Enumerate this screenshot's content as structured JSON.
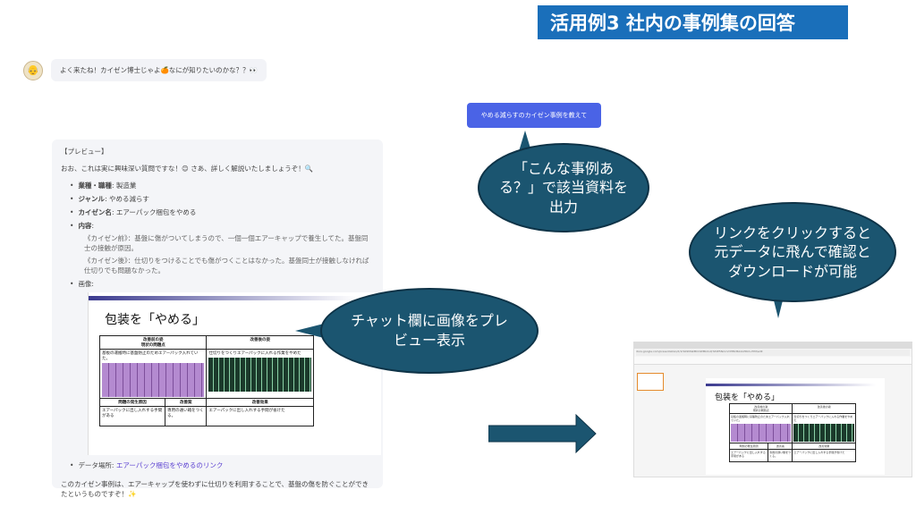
{
  "banner": {
    "title": "活用例3 社内の事例集の回答"
  },
  "chat": {
    "greeting": "よく来たね！カイゼン博士じゃよ🍊なにが知りたいのかな？？👀",
    "user_message": "やめる減らすのカイゼン事例を教えて",
    "preview_label": "【プレビュー】",
    "intro": "おお、これは実に興味深い質問ですな！😊 さあ、詳しく解説いたしましょうぞ！🔍",
    "items": [
      {
        "key": "業種・職種",
        "value": ": 製造業"
      },
      {
        "key": "ジャンル",
        "value": ": やめる減らす"
      },
      {
        "key": "カイゼン名",
        "value": ": エアーパック梱包をやめる"
      },
      {
        "key": "内容",
        "value": ":"
      }
    ],
    "sub_items": [
      "《カイゼン前》：基盤に傷がついてしまうので、一個一個エアーキャップで養生してた。基盤同士の接触が原因。",
      "《カイゼン後》：仕切りをつけることでも傷がつくことはなかった。基盤同士が接触しなければ仕切りでも問題なかった。"
    ],
    "image_label": "画像:",
    "data_location_label": "データ場所:",
    "data_location_link": "エアーパック梱包をやめるのリンク",
    "conclusion": "このカイゼン事例は、エアーキャップを使わずに仕切りを利用することで、基盤の傷を防ぐことができたというものですぞ！✨"
  },
  "slide": {
    "title": "包装を「やめる」",
    "col1_header": "改善前の姿\n現状の問題点",
    "col2_header": "改善後の姿",
    "col1_text": "基板の運搬時に基盤防止のためエアーパック入れていた。",
    "col2_text": "仕切りをつくりエアーパックに入れる作業をやめた",
    "row2_col1a": "問題の発生原因",
    "row2_col1b": "改善案",
    "row2_col2": "改善効果",
    "row3_col1a": "エアーパックに出し入れする手間がある",
    "row3_col1b": "専用の通い箱をつくる。",
    "row3_col2": "エアーパックに出し入れする手間が省けた"
  },
  "callouts": {
    "c1": "「こんな事例ある？」で該当資料を出力",
    "c2": "チャット欄に画像をプレビュー表示",
    "c3": "リンクをクリックすると元データに飛んで確認とダウンロードが可能"
  },
  "browser": {
    "url": "docs.google.com/presentation/d/1rS09MIatMCOWMkXvQ7ZdP5NmcVdHMcBAULPDk1vTrM/edit"
  },
  "colors": {
    "banner": "#1a6fba",
    "bubble": "#1b5570",
    "user_bubble": "#4a63e6",
    "link": "#5a3fd1"
  }
}
